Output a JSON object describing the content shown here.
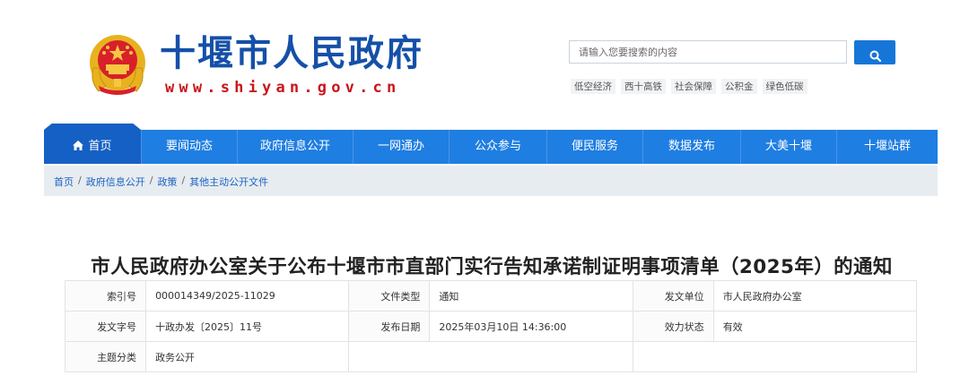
{
  "header": {
    "site_title": "十堰市人民政府",
    "site_domain": "www.shiyan.gov.cn"
  },
  "search": {
    "placeholder": "请输入您要搜索的内容",
    "hot_tags": [
      "低空经济",
      "西十高铁",
      "社会保障",
      "公积金",
      "绿色低碳"
    ]
  },
  "nav": {
    "items": [
      "首页",
      "要闻动态",
      "政府信息公开",
      "一网通办",
      "公众参与",
      "便民服务",
      "数据发布",
      "大美十堰",
      "十堰站群"
    ]
  },
  "breadcrumb": {
    "items": [
      "首页",
      "政府信息公开",
      "政策",
      "其他主动公开文件"
    ],
    "separator": "/"
  },
  "document": {
    "title": "市人民政府办公室关于公布十堰市市直部门实行告知承诺制证明事项清单（2025年）的通知",
    "info": {
      "index_label": "索引号",
      "index_value": "000014349/2025-11029",
      "type_label": "文件类型",
      "type_value": "通知",
      "issuer_label": "发文单位",
      "issuer_value": "市人民政府办公室",
      "doc_no_label": "发文字号",
      "doc_no_value": "十政办发〔2025〕11号",
      "date_label": "发布日期",
      "date_value": "2025年03月10日 14:36:00",
      "status_label": "效力状态",
      "status_value": "有效",
      "topic_label": "主题分类",
      "topic_value": "政务公开"
    }
  },
  "colors": {
    "nav_bg": "#1f7ee2",
    "nav_active": "#1560c4",
    "title_blue": "#1550a8",
    "domain_red": "#c8161d",
    "emblem_gold": "#e8b21e",
    "emblem_red": "#d8202a"
  },
  "icons": {
    "emblem": "national-emblem",
    "search": "search-icon",
    "home": "home-icon"
  }
}
